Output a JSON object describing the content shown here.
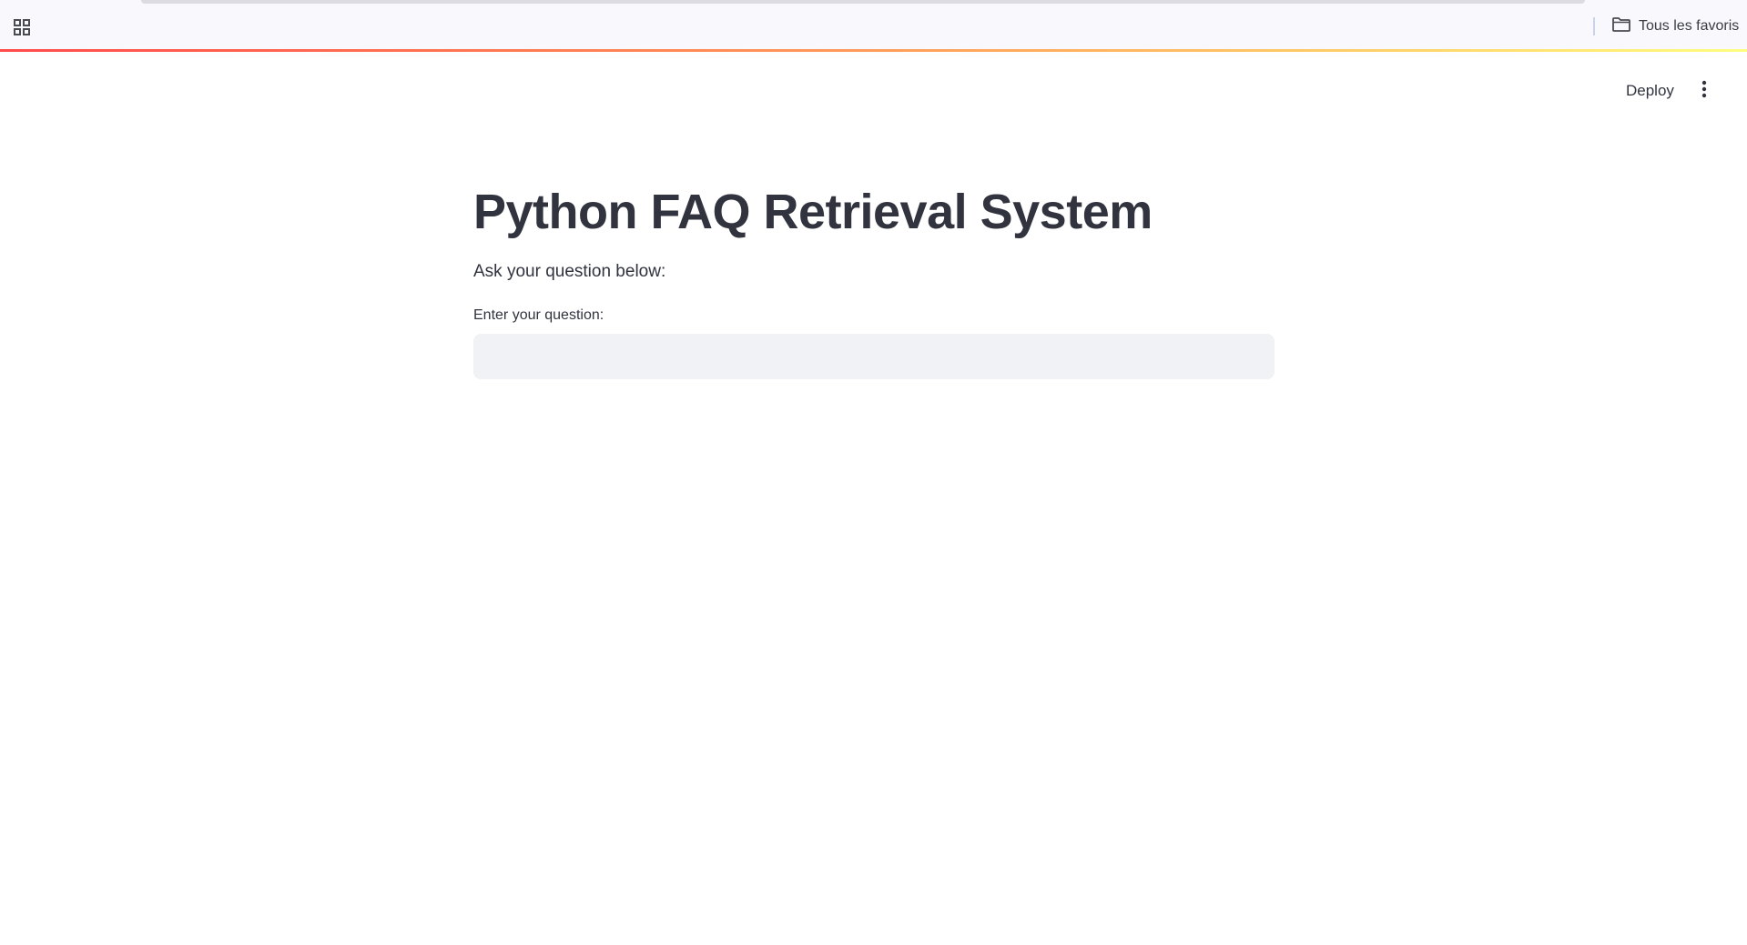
{
  "browser": {
    "apps_icon": "apps-grid-icon",
    "bookmarks_folder_icon": "folder-icon",
    "bookmarks_all_label": "Tous les favoris"
  },
  "toolbar": {
    "deploy_label": "Deploy",
    "menu_icon": "vertical-dots-icon"
  },
  "main": {
    "title": "Python FAQ Retrieval System",
    "subtitle": "Ask your question below:",
    "question_label": "Enter your question:",
    "question_value": "",
    "question_placeholder": ""
  },
  "colors": {
    "accent_gradient": [
      "#ff4b4b",
      "#ff8a55",
      "#ffd36a",
      "#fffd80"
    ],
    "text": "#31333f",
    "input_background": "#f0f2f6"
  }
}
